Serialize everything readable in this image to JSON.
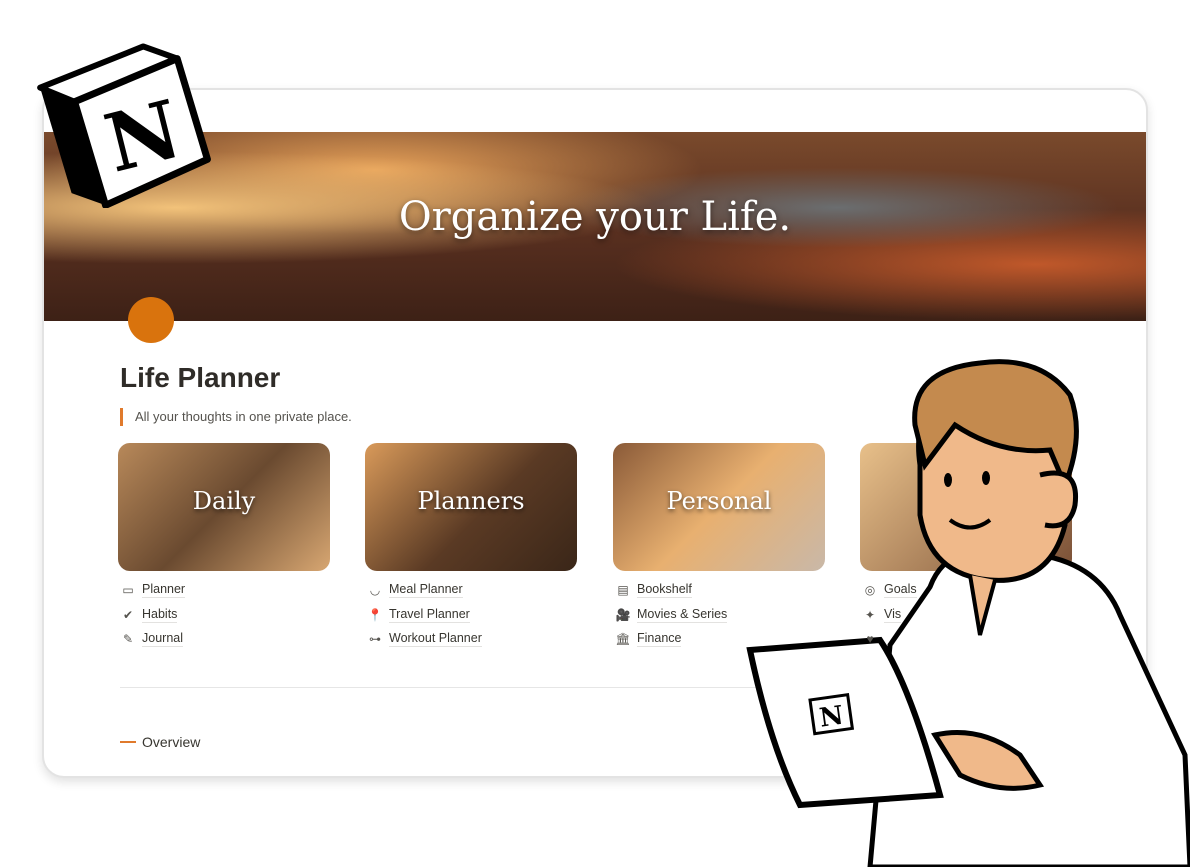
{
  "banner": {
    "title": "Organize your Life."
  },
  "page": {
    "title": "Life Planner",
    "quote": "All your thoughts in one private place."
  },
  "columns": [
    {
      "title": "Daily",
      "links": [
        {
          "icon": "calendar-icon",
          "glyph": "▭",
          "label": "Planner"
        },
        {
          "icon": "check-circle-icon",
          "glyph": "✔",
          "label": "Habits"
        },
        {
          "icon": "brush-icon",
          "glyph": "✎",
          "label": "Journal"
        }
      ]
    },
    {
      "title": "Planners",
      "links": [
        {
          "icon": "bowl-icon",
          "glyph": "◡",
          "label": "Meal Planner"
        },
        {
          "icon": "pin-icon",
          "glyph": "📍",
          "label": "Travel Planner"
        },
        {
          "icon": "dumbbell-icon",
          "glyph": "⊶",
          "label": "Workout Planner"
        }
      ]
    },
    {
      "title": "Personal",
      "links": [
        {
          "icon": "books-icon",
          "glyph": "▤",
          "label": "Bookshelf"
        },
        {
          "icon": "film-camera-icon",
          "glyph": "🎥",
          "label": "Movies & Series"
        },
        {
          "icon": "bank-icon",
          "glyph": "🏛",
          "label": "Finance"
        }
      ]
    },
    {
      "title": "",
      "links": [
        {
          "icon": "target-icon",
          "glyph": "◎",
          "label": "Goals"
        },
        {
          "icon": "sparkles-icon",
          "glyph": "✦",
          "label": "Vis"
        },
        {
          "icon": "heart-icon",
          "glyph": "♥",
          "label": ""
        }
      ]
    }
  ],
  "overview": {
    "label": "Overview"
  },
  "colors": {
    "accent": "#d9730d",
    "quote_bar": "#e07a2c",
    "text": "#37352f"
  },
  "logo": {
    "text": "N"
  }
}
